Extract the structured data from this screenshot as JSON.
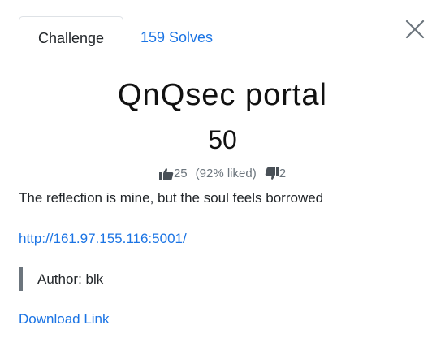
{
  "tabs": {
    "challenge_label": "Challenge",
    "solves_label": "159 Solves"
  },
  "challenge": {
    "title": "QnQsec portal",
    "points": "50",
    "likes": "25",
    "liked_percent": "(92% liked)",
    "dislikes": "2",
    "description": "The reflection is mine, but the soul feels borrowed",
    "url": "http://161.97.155.116:5001/",
    "author": "Author: blk",
    "download_label": "Download Link"
  },
  "icons": {
    "close": "close-icon",
    "like": "thumbs-up-icon",
    "dislike": "thumbs-down-icon"
  },
  "colors": {
    "link": "#1b74e4",
    "muted": "#6c757d",
    "border": "#dee2e6"
  }
}
